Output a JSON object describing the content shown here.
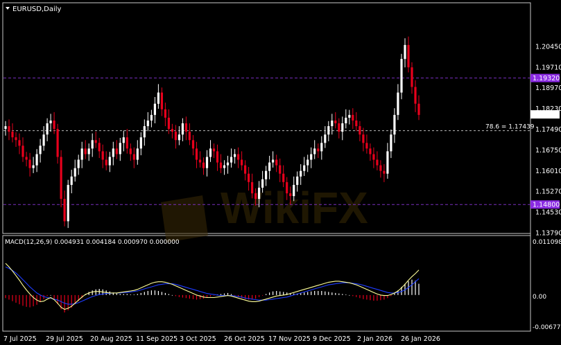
{
  "chart_data": [
    {
      "type": "candlestick",
      "title": "EURUSD,Daily",
      "watermark": "WikiFX",
      "colors": {
        "up": "#ffffff",
        "down": "#e8001c",
        "grid_dash": "#ffffff",
        "level_line": "#7a2fbf",
        "level_tag": "#8a2be2"
      },
      "y_ticks": [
        "1.20450",
        "1.19710",
        "1.18970",
        "1.18230",
        "1.17490",
        "1.16750",
        "1.16010",
        "1.15270",
        "1.14530",
        "1.13790"
      ],
      "ylim": [
        1.1379,
        1.2119
      ],
      "x_labels": [
        "7 Jul 2025",
        "29 Jul 2025",
        "20 Aug 2025",
        "11 Sep 2025",
        "3 Oct 2025",
        "26 Oct 2025",
        "17 Nov 2025",
        "9 Dec 2025",
        "2 Jan 2026",
        "26 Jan 2026"
      ],
      "current_price": "1.18020",
      "current_price_value": 1.1802,
      "fib_label": "78.6 = 1.17439",
      "fib_value": 1.17439,
      "level_upper": {
        "label": "1.19320",
        "value": 1.1932
      },
      "level_lower": {
        "label": "1.14800",
        "value": 1.148
      },
      "closes": [
        1.176,
        1.174,
        1.172,
        1.171,
        1.169,
        1.165,
        1.164,
        1.161,
        1.162,
        1.166,
        1.169,
        1.173,
        1.177,
        1.178,
        1.175,
        1.165,
        1.15,
        1.142,
        1.155,
        1.158,
        1.161,
        1.164,
        1.168,
        1.166,
        1.168,
        1.171,
        1.17,
        1.167,
        1.164,
        1.162,
        1.165,
        1.168,
        1.166,
        1.17,
        1.172,
        1.168,
        1.166,
        1.164,
        1.168,
        1.172,
        1.176,
        1.178,
        1.18,
        1.184,
        1.188,
        1.182,
        1.179,
        1.175,
        1.174,
        1.171,
        1.173,
        1.177,
        1.174,
        1.171,
        1.168,
        1.164,
        1.163,
        1.161,
        1.165,
        1.168,
        1.167,
        1.163,
        1.161,
        1.162,
        1.163,
        1.165,
        1.166,
        1.164,
        1.162,
        1.159,
        1.156,
        1.152,
        1.15,
        1.154,
        1.157,
        1.16,
        1.163,
        1.164,
        1.162,
        1.159,
        1.156,
        1.152,
        1.151,
        1.155,
        1.158,
        1.16,
        1.162,
        1.164,
        1.166,
        1.168,
        1.167,
        1.17,
        1.173,
        1.176,
        1.178,
        1.177,
        1.174,
        1.177,
        1.179,
        1.18,
        1.178,
        1.176,
        1.173,
        1.17,
        1.168,
        1.166,
        1.164,
        1.162,
        1.16,
        1.159,
        1.167,
        1.173,
        1.18,
        1.188,
        1.2,
        1.205,
        1.197,
        1.19,
        1.184,
        1.18
      ]
    },
    {
      "type": "macd",
      "label": "MACD(12,26,9) 0.004931 0.004184 0.000970 0.000000",
      "y_ticks": [
        "0.011098",
        "0.00",
        "-0.006774"
      ],
      "ylim": [
        -0.0068,
        0.0111
      ],
      "colors": {
        "hist_pos": "#ffffff",
        "hist_neg": "#e8001c",
        "macd_line": "#ffff99",
        "signal_line": "#1e3cff"
      },
      "histogram": [
        -0.0006,
        -0.0009,
        -0.0012,
        -0.0015,
        -0.0018,
        -0.0021,
        -0.0023,
        -0.0024,
        -0.0022,
        -0.0019,
        -0.0014,
        -0.0008,
        -0.0002,
        0,
        -0.0008,
        -0.0018,
        -0.0028,
        -0.0034,
        -0.003,
        -0.0025,
        -0.0018,
        -0.0012,
        -0.0006,
        0.0002,
        0.0006,
        0.0009,
        0.0011,
        0.0012,
        0.0011,
        0.0009,
        0.0007,
        0.0005,
        0.0003,
        0.0002,
        0.0002,
        0.0002,
        0.0001,
        0.0001,
        0.0002,
        0.0004,
        0.0006,
        0.0008,
        0.0009,
        0.0009,
        0.0008,
        0.0006,
        0.0004,
        0.0002,
        0,
        -0.0002,
        -0.0004,
        -0.0005,
        -0.0006,
        -0.0007,
        -0.0008,
        -0.0009,
        -0.0008,
        -0.0007,
        -0.0005,
        -0.0003,
        -0.0001,
        0.0001,
        0.0002,
        0.0003,
        0.0004,
        0.0002,
        -0.0001,
        -0.0004,
        -0.0006,
        -0.0008,
        -0.0009,
        -0.0009,
        -0.0007,
        -0.0004,
        -0.0001,
        0.0002,
        0.0005,
        0.0007,
        0.0008,
        0.0007,
        0.0006,
        0.0005,
        0.0004,
        0.0003,
        0.0003,
        0.0004,
        0.0005,
        0.0006,
        0.0007,
        0.0008,
        0.0008,
        0.0008,
        0.0007,
        0.0006,
        0.0005,
        0.0004,
        0.0003,
        0.0002,
        0.0001,
        0,
        -0.0002,
        -0.0004,
        -0.0006,
        -0.0008,
        -0.0009,
        -0.001,
        -0.0011,
        -0.0011,
        -0.001,
        -0.0009,
        -0.0006,
        -0.0002,
        0.0003,
        0.0009,
        0.0016,
        0.0022,
        0.0027,
        0.003,
        0.0028,
        0.0022
      ],
      "macd": [
        0.0062,
        0.0055,
        0.0047,
        0.0038,
        0.0029,
        0.0019,
        0.001,
        0.0002,
        -0.0005,
        -0.001,
        -0.0013,
        -0.0012,
        -0.0008,
        -0.0005,
        -0.0009,
        -0.0016,
        -0.0024,
        -0.0028,
        -0.0026,
        -0.0022,
        -0.0016,
        -0.001,
        -0.0004,
        0.0001,
        0.0004,
        0.0006,
        0.0007,
        0.0007,
        0.0006,
        0.0005,
        0.0004,
        0.0004,
        0.0004,
        0.0005,
        0.0006,
        0.0007,
        0.0008,
        0.0009,
        0.0011,
        0.0014,
        0.0017,
        0.002,
        0.0023,
        0.0025,
        0.0026,
        0.0026,
        0.0025,
        0.0023,
        0.0021,
        0.0018,
        0.0015,
        0.0012,
        0.0009,
        0.0006,
        0.0003,
        0,
        -0.0002,
        -0.0004,
        -0.0005,
        -0.0005,
        -0.0005,
        -0.0004,
        -0.0003,
        -0.0002,
        -0.0001,
        -0.0002,
        -0.0004,
        -0.0006,
        -0.0008,
        -0.001,
        -0.0012,
        -0.0013,
        -0.0013,
        -0.0012,
        -0.001,
        -0.0008,
        -0.0006,
        -0.0004,
        -0.0002,
        -0.0001,
        0,
        0.0001,
        0.0003,
        0.0005,
        0.0007,
        0.0009,
        0.0011,
        0.0013,
        0.0015,
        0.0017,
        0.0019,
        0.0021,
        0.0023,
        0.0025,
        0.0026,
        0.0027,
        0.0027,
        0.0026,
        0.0025,
        0.0024,
        0.0022,
        0.002,
        0.0017,
        0.0014,
        0.0011,
        0.0008,
        0.0005,
        0.0002,
        0,
        -0.0001,
        -0.0001,
        0.0001,
        0.0004,
        0.0008,
        0.0014,
        0.0021,
        0.0029,
        0.0036,
        0.0042,
        0.0049
      ],
      "signal": [
        0.0055,
        0.0052,
        0.0048,
        0.0043,
        0.0037,
        0.003,
        0.0023,
        0.0016,
        0.001,
        0.0004,
        0,
        -0.0003,
        -0.0005,
        -0.0006,
        -0.0008,
        -0.001,
        -0.0013,
        -0.0016,
        -0.0018,
        -0.0018,
        -0.0017,
        -0.0015,
        -0.0012,
        -0.0009,
        -0.0006,
        -0.0003,
        -0.0001,
        0.0001,
        0.0002,
        0.0003,
        0.0003,
        0.0004,
        0.0004,
        0.0004,
        0.0005,
        0.0005,
        0.0006,
        0.0007,
        0.0008,
        0.001,
        0.0012,
        0.0014,
        0.0016,
        0.0018,
        0.002,
        0.0021,
        0.0022,
        0.0022,
        0.0022,
        0.0021,
        0.0019,
        0.0017,
        0.0015,
        0.0013,
        0.0011,
        0.0009,
        0.0007,
        0.0005,
        0.0003,
        0.0002,
        0.0001,
        0,
        -0.0001,
        -0.0001,
        -0.0001,
        -0.0001,
        -0.0002,
        -0.0003,
        -0.0004,
        -0.0006,
        -0.0007,
        -0.0008,
        -0.0009,
        -0.001,
        -0.001,
        -0.001,
        -0.0009,
        -0.0008,
        -0.0007,
        -0.0006,
        -0.0005,
        -0.0004,
        -0.0002,
        0,
        0.0002,
        0.0004,
        0.0006,
        0.0008,
        0.001,
        0.0012,
        0.0014,
        0.0016,
        0.0018,
        0.002,
        0.0021,
        0.0022,
        0.0023,
        0.0024,
        0.0024,
        0.0024,
        0.0023,
        0.0022,
        0.0021,
        0.0019,
        0.0017,
        0.0015,
        0.0013,
        0.0011,
        0.0009,
        0.0007,
        0.0005,
        0.0004,
        0.0004,
        0.0005,
        0.0007,
        0.001,
        0.0015,
        0.002,
        0.0026,
        0.0032
      ]
    }
  ]
}
